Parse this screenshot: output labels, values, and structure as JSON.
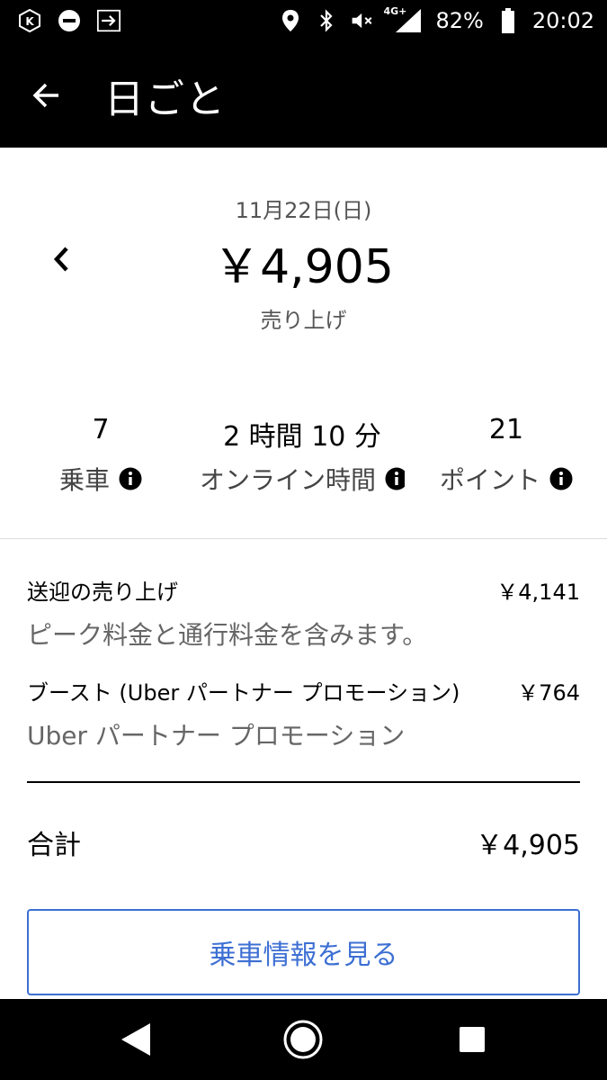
{
  "status_bar": {
    "network": "4G+",
    "battery": "82%",
    "time": "20:02",
    "icons": [
      "k-app-icon",
      "minus-circle-icon",
      "arrow-box-icon",
      "location-icon",
      "bluetooth-icon",
      "mute-icon",
      "signal-icon",
      "battery-icon"
    ]
  },
  "app_bar": {
    "title": "日ごと"
  },
  "summary": {
    "date": "11月22日(日)",
    "amount": "￥4,905",
    "caption": "売り上げ"
  },
  "stats": {
    "rides_value": "7",
    "rides_label": "乗車",
    "online_value": "2 時間 10 分",
    "online_label": "オンライン時間",
    "points_value": "21",
    "points_label": "ポイント"
  },
  "breakdown": {
    "fares_label": "送迎の売り上げ",
    "fares_amount": "￥4,141",
    "fares_sub": "ピーク料金と通行料金を含みます。",
    "boost_label": "ブースト (Uber パートナー プロモーション)",
    "boost_amount": "￥764",
    "boost_sub": "Uber パートナー プロモーション"
  },
  "total": {
    "label": "合計",
    "amount": "￥4,905"
  },
  "actions": {
    "view_trips": "乗車情報を見る"
  },
  "colors": {
    "accent": "#3d6fd3",
    "bar_bg": "#000000"
  }
}
